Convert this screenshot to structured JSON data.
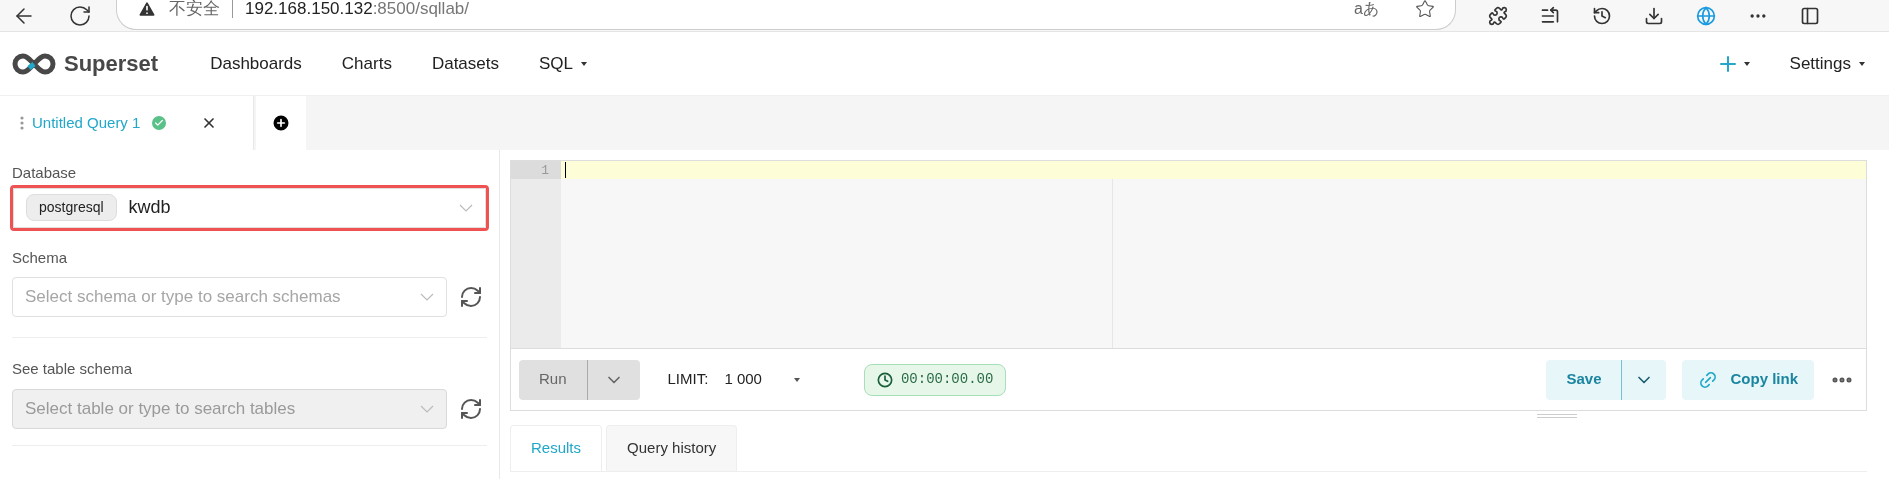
{
  "browser": {
    "security": "不安全",
    "url_host": "192.168.150.132",
    "url_rest": ":8500/sqllab/",
    "translate": "aあ"
  },
  "nav": {
    "brand": "Superset",
    "items": [
      {
        "label": "Dashboards",
        "dropdown": false
      },
      {
        "label": "Charts",
        "dropdown": false
      },
      {
        "label": "Datasets",
        "dropdown": false
      },
      {
        "label": "SQL",
        "dropdown": true
      }
    ],
    "settings": "Settings"
  },
  "query_tabs": [
    {
      "label": "Untitled Query 1",
      "selected": true,
      "succeeded": true
    }
  ],
  "sidebar": {
    "database": {
      "label": "Database",
      "engine": "postgresql",
      "value": "kwdb",
      "highlighted": true
    },
    "schema": {
      "label": "Schema",
      "placeholder": "Select schema or type to search schemas",
      "disabled": false
    },
    "table": {
      "label": "See table schema",
      "placeholder": "Select table or type to search tables",
      "disabled": true
    }
  },
  "editor": {
    "line_numbers": [
      "1"
    ]
  },
  "toolbar": {
    "run": "Run",
    "limit_label": "LIMIT:",
    "limit_value": "1 000",
    "timer": "00:00:00.00",
    "save": "Save",
    "copy_link": "Copy link"
  },
  "result_tabs": [
    {
      "label": "Results",
      "selected": true
    },
    {
      "label": "Query history",
      "selected": false
    }
  ]
}
